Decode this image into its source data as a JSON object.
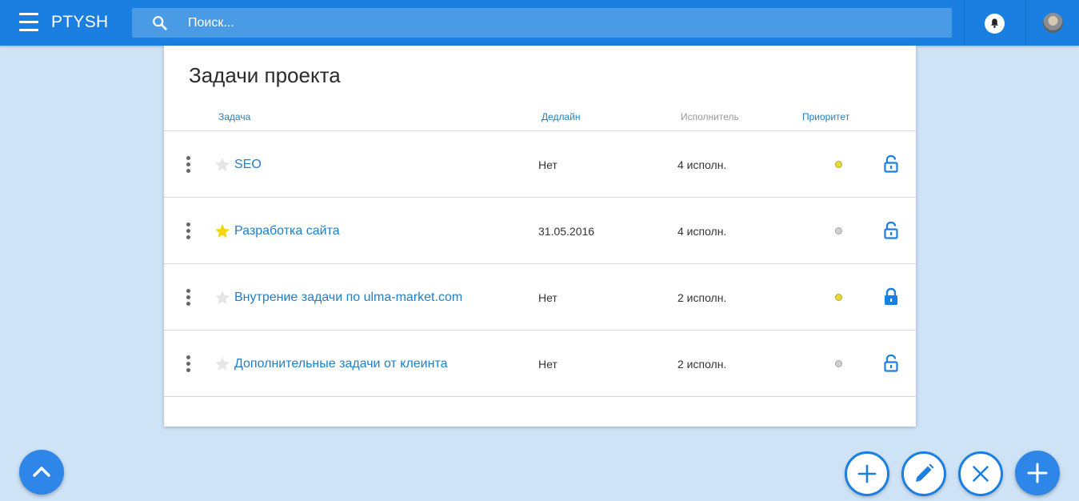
{
  "app": {
    "brand": "PTYSH"
  },
  "search": {
    "placeholder": "Поиск..."
  },
  "card": {
    "title": "Задачи проекта",
    "columns": {
      "task": "Задача",
      "deadline": "Дедлайн",
      "assignee": "Исполнитель",
      "priority": "Приоритет"
    }
  },
  "tasks": [
    {
      "name": "SEO",
      "starred": false,
      "deadline": "Нет",
      "assignees": "4 исполн.",
      "priority_color": "#e8d838",
      "locked": false
    },
    {
      "name": "Разработка сайта",
      "starred": true,
      "deadline": "31.05.2016",
      "assignees": "4 исполн.",
      "priority_color": "#cfcfcf",
      "locked": false
    },
    {
      "name": "Внутрение задачи по ulma-market.com",
      "starred": false,
      "deadline": "Нет",
      "assignees": "2 исполн.",
      "priority_color": "#e8d838",
      "locked": true
    },
    {
      "name": "Дополнительные задачи от клеинта",
      "starred": false,
      "deadline": "Нет",
      "assignees": "2 исполн.",
      "priority_color": "#cfcfcf",
      "locked": false
    }
  ],
  "colors": {
    "accent": "#1a7fe0",
    "link": "#1f7fc8",
    "star_active": "#f5d800",
    "star_inactive": "#e6e6e6"
  },
  "icons": {
    "menu": "menu-icon",
    "search": "search-icon",
    "notifications": "bell-icon",
    "row_menu": "more-vert-icon",
    "star": "star-icon",
    "lock_open": "lock-open-icon",
    "lock_closed": "lock-closed-icon",
    "scroll_up": "chevron-up-icon",
    "add": "plus-icon",
    "edit": "pencil-icon",
    "close": "close-icon"
  }
}
